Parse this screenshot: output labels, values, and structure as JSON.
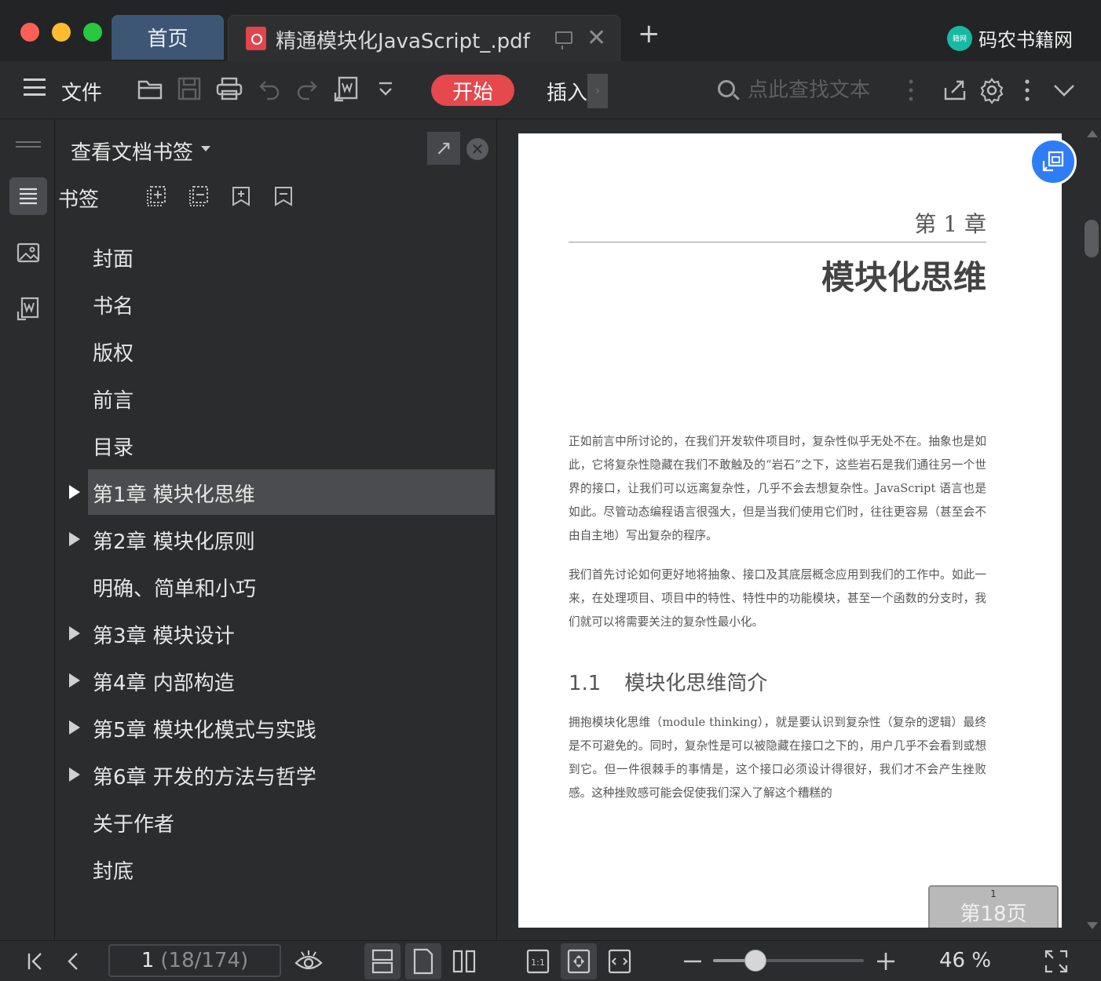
{
  "tabs": {
    "home_label": "首页",
    "doc_title": "精通模块化JavaScript_.pdf",
    "close_glyph": "✕",
    "new_tab_glyph": "+"
  },
  "brand": {
    "logo_text": "籍网",
    "name": "码农书籍网"
  },
  "toolbar": {
    "file_label": "文件",
    "start_label": "开始",
    "insert_label": "插入",
    "insert_more_glyph": "›",
    "search_placeholder": "点此查找文本",
    "accent_color": "#e5484d"
  },
  "panel": {
    "title": "查看文档书签",
    "bookmark_label": "书签",
    "close_glyph": "✕",
    "float_glyph": "↗",
    "items": [
      {
        "label": "封面",
        "expandable": false,
        "selected": false
      },
      {
        "label": "书名",
        "expandable": false,
        "selected": false
      },
      {
        "label": "版权",
        "expandable": false,
        "selected": false
      },
      {
        "label": "前言",
        "expandable": false,
        "selected": false
      },
      {
        "label": "目录",
        "expandable": false,
        "selected": false
      },
      {
        "label": "第1章 模块化思维",
        "expandable": true,
        "selected": true
      },
      {
        "label": "第2章 模块化原则",
        "expandable": true,
        "selected": false
      },
      {
        "label": "明确、简单和小巧",
        "expandable": false,
        "selected": false
      },
      {
        "label": "第3章 模块设计",
        "expandable": true,
        "selected": false
      },
      {
        "label": "第4章 内部构造",
        "expandable": true,
        "selected": false
      },
      {
        "label": "第5章 模块化模式与实践",
        "expandable": true,
        "selected": false
      },
      {
        "label": "第6章 开发的方法与哲学",
        "expandable": true,
        "selected": false
      },
      {
        "label": "关于作者",
        "expandable": false,
        "selected": false
      },
      {
        "label": "封底",
        "expandable": false,
        "selected": false
      }
    ]
  },
  "page": {
    "chapter": "第 1 章",
    "heading": "模块化思维",
    "para1": "正如前言中所讨论的，在我们开发软件项目时，复杂性似乎无处不在。抽象也是如此，它将复杂性隐藏在我们不敢触及的“岩石”之下，这些岩石是我们通往另一个世界的接口，让我们可以远离复杂性，几乎不会去想复杂性。JavaScript 语言也是如此。尽管动态编程语言很强大，但是当我们使用它们时，往往更容易（甚至会不由自主地）写出复杂的程序。",
    "para2": "我们首先讨论如何更好地将抽象、接口及其底层概念应用到我们的工作中。如此一来，在处理项目、项目中的特性、特性中的功能模块，甚至一个函数的分支时，我们就可以将需要关注的复杂性最小化。",
    "section_number": "1.1",
    "section_title": "模块化思维简介",
    "para3": "拥抱模块化思维（module thinking），就是要认识到复杂性（复杂的逻辑）最终是不可避免的。同时，复杂性是可以被隐藏在接口之下的，用户几乎不会看到或想到它。但一件很棘手的事情是，这个接口必须设计得很好，我们才不会产生挫败感。这种挫败感可能会促使我们深入了解这个糟糕的",
    "badge_small": "1",
    "badge_text": "第18页"
  },
  "statusbar": {
    "page_current": "1",
    "page_total": "(18/174)",
    "zoom_label": "46 %",
    "zoom_fraction": 0.28
  }
}
